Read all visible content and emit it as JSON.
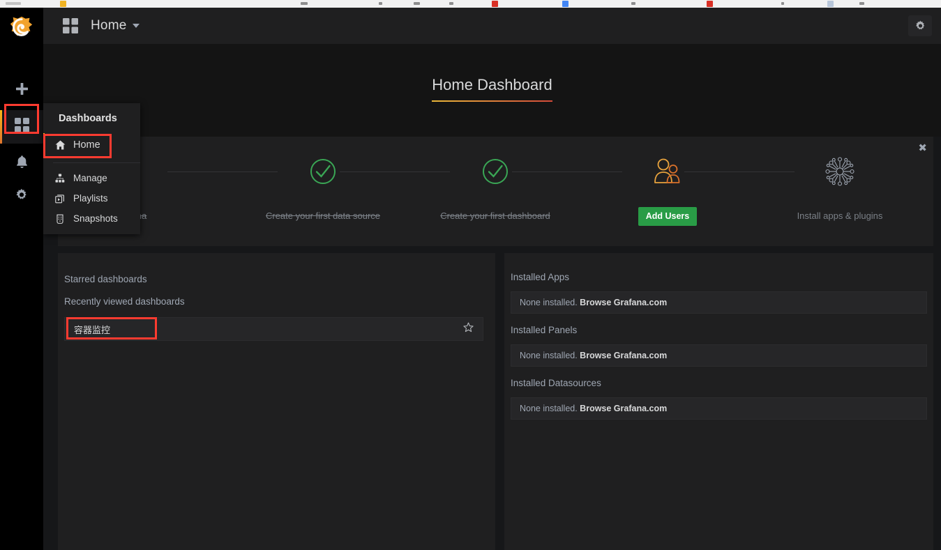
{
  "browser": {
    "bookmarks": [
      "",
      "",
      "",
      "",
      "",
      "",
      "",
      "",
      "",
      "",
      "",
      "",
      ""
    ]
  },
  "sidebar": {
    "logo_name": "grafana-logo",
    "items": [
      {
        "name": "create-add",
        "icon": "plus-icon",
        "label": "Create",
        "active": false
      },
      {
        "name": "dashboards",
        "icon": "grid-icon",
        "label": "Dashboards",
        "active": true
      },
      {
        "name": "alerting",
        "icon": "bell-icon",
        "label": "Alerting",
        "active": false
      },
      {
        "name": "configuration",
        "icon": "gear-icon",
        "label": "Configuration",
        "active": false
      }
    ]
  },
  "topnav": {
    "grid_icon": "grid-icon",
    "breadcrumb": "Home",
    "caret_icon": "chevron-down-icon",
    "settings_icon": "gear-icon"
  },
  "page": {
    "title": "Home Dashboard"
  },
  "dashboards_menu": {
    "title": "Dashboards",
    "items": [
      {
        "label": "Home",
        "icon": "home-icon",
        "active": true
      },
      {
        "label": "Manage",
        "icon": "sitemap-icon",
        "active": false
      },
      {
        "label": "Playlists",
        "icon": "playlist-icon",
        "active": false
      },
      {
        "label": "Snapshots",
        "icon": "snapshot-icon",
        "active": false
      }
    ]
  },
  "onboarding": {
    "close_label": "✖",
    "steps": [
      {
        "label": "Install Grafana",
        "state": "done",
        "icon": "check-circle-icon"
      },
      {
        "label": "Create your first data source",
        "state": "done",
        "icon": "check-circle-icon"
      },
      {
        "label": "Create your first dashboard",
        "state": "done",
        "icon": "check-circle-icon"
      },
      {
        "label": "Add Users",
        "state": "action",
        "icon": "users-icon"
      },
      {
        "label": "Install apps & plugins",
        "state": "pending",
        "icon": "apps-plugins-icon"
      }
    ]
  },
  "left_panel": {
    "starred_heading": "Starred dashboards",
    "recent_heading": "Recently viewed dashboards",
    "recent_items": [
      {
        "title": "容器监控",
        "star_icon": "star-outline-icon"
      }
    ]
  },
  "right_panel": {
    "sections": [
      {
        "heading": "Installed Apps",
        "none_text": "None installed. ",
        "link_text": "Browse Grafana.com"
      },
      {
        "heading": "Installed Panels",
        "none_text": "None installed. ",
        "link_text": "Browse Grafana.com"
      },
      {
        "heading": "Installed Datasources",
        "none_text": "None installed. ",
        "link_text": "Browse Grafana.com"
      }
    ]
  },
  "colors": {
    "accent_orange": "#e0752d",
    "accent_yellow": "#f9b716",
    "green_done": "#3aa655",
    "green_button": "#299c46",
    "annotation_red": "#ff3b30",
    "panel_bg": "#1f1f20",
    "page_bg": "#161719"
  }
}
